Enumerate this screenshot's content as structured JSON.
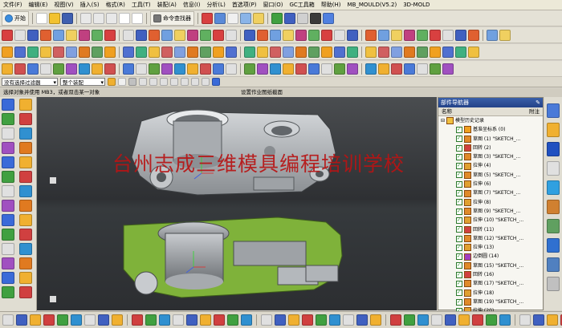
{
  "menu": [
    "文件(F)",
    "编辑(E)",
    "视图(V)",
    "插入(S)",
    "格式(R)",
    "工具(T)",
    "装配(A)",
    "信息(I)",
    "分析(L)",
    "首选项(P)",
    "窗口(O)",
    "GC工具箱",
    "帮助(H)",
    "MB_MOULD(V5.2)",
    "3D-MOLD"
  ],
  "toolbar": {
    "start_label": "开始",
    "command_finder_label": "命令查找器"
  },
  "selection_bar": {
    "filter_value": "没有选择过滤器",
    "assembly_value": "整个装配"
  },
  "status": {
    "left": "选择对象并使用 MB3，或者双击某一对象",
    "center": "设置作业图纸截面"
  },
  "watermark": "台州志成三维模具编程培训学校",
  "part_navigator": {
    "title": "部件导航器",
    "col_name": "名称",
    "col_attach": "附注",
    "root": "模型历史记录",
    "items": [
      {
        "icon": "datum",
        "label": "基准坐标系 (0)"
      },
      {
        "icon": "sketch",
        "label": "草图 (1) \"SKETCH_..."
      },
      {
        "icon": "revolve",
        "label": "回转 (2)"
      },
      {
        "icon": "sketch",
        "label": "草图 (3) \"SKETCH_..."
      },
      {
        "icon": "extrude",
        "label": "拉伸 (4)"
      },
      {
        "icon": "sketch",
        "label": "草图 (5) \"SKETCH_..."
      },
      {
        "icon": "extrude",
        "label": "拉伸 (6)"
      },
      {
        "icon": "sketch",
        "label": "草图 (7) \"SKETCH_..."
      },
      {
        "icon": "extrude",
        "label": "拉伸 (8)"
      },
      {
        "icon": "sketch",
        "label": "草图 (9) \"SKETCH_..."
      },
      {
        "icon": "extrude",
        "label": "拉伸 (10) \"SKETCH_..."
      },
      {
        "icon": "revolve",
        "label": "回转 (11)"
      },
      {
        "icon": "sketch",
        "label": "草图 (12) \"SKETCH_..."
      },
      {
        "icon": "extrude",
        "label": "拉伸 (13)"
      },
      {
        "icon": "shell",
        "label": "边倒圆 (14)"
      },
      {
        "icon": "sketch",
        "label": "草图 (15) \"SKETCH_..."
      },
      {
        "icon": "revolve",
        "label": "回转 (16)"
      },
      {
        "icon": "sketch",
        "label": "草图 (17) \"SKETCH_..."
      },
      {
        "icon": "extrude",
        "label": "拉伸 (18)"
      },
      {
        "icon": "sketch",
        "label": "草图 (19) \"SKETCH_..."
      },
      {
        "icon": "extrude",
        "label": "拉伸 (20)"
      },
      {
        "icon": "sketch",
        "label": "草图 (21)"
      }
    ]
  },
  "colors": {
    "viewport_top": "#4a4d50",
    "viewport_bottom": "#2c2e31",
    "part_gray": "#b9bcbf",
    "section_green": "#7fb23a",
    "watermark": "#b81414",
    "nav_title": "#234288"
  }
}
